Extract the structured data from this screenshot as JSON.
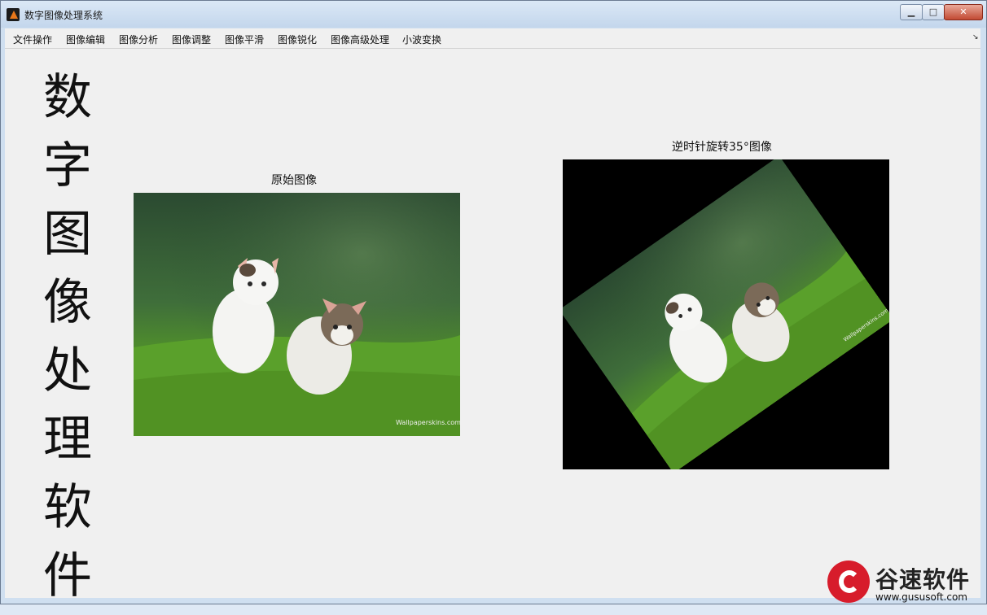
{
  "window": {
    "title": "数字图像处理系统",
    "buttons": {
      "minimize": "▁",
      "maximize": "□",
      "close": "✕"
    }
  },
  "menu": {
    "items": [
      "文件操作",
      "图像编辑",
      "图像分析",
      "图像调整",
      "图像平滑",
      "图像锐化",
      "图像高级处理",
      "小波变换"
    ],
    "overflow_icon": "↘"
  },
  "content": {
    "vertical_title": [
      "数",
      "字",
      "图",
      "像",
      "处",
      "理",
      "软",
      "件"
    ],
    "original_title": "原始图像",
    "rotated_title": "逆时针旋转35°图像",
    "rotation_degrees": 35
  },
  "watermark": {
    "brand": "谷速软件",
    "url": "www.gususoft.com"
  },
  "colors": {
    "close_button": "#c24a33",
    "watermark_red": "#d71c2b",
    "client_bg": "#f0f0f0"
  },
  "icons": {
    "app": "matlab-icon",
    "image_original": "kittens-photo",
    "image_rotated": "kittens-photo-rotated"
  }
}
